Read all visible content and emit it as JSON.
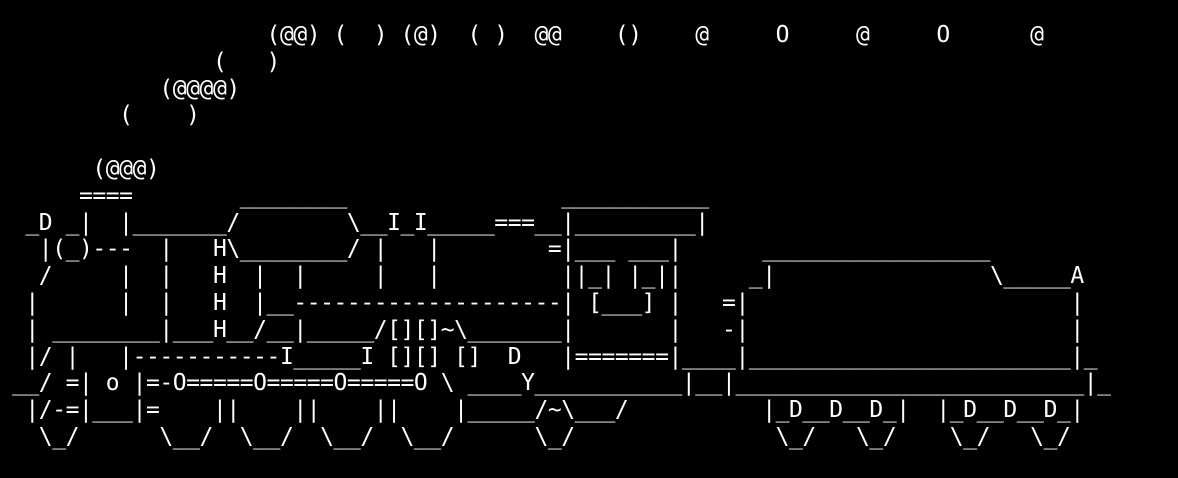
{
  "terminal": {
    "background": "#000000",
    "foreground": "#ffffff",
    "lines": [
      "                   (@@) (  ) (@)  ( )  @@    ()    @     O     @     O      @",
      "               (   )",
      "           (@@@@)",
      "        (    )",
      "",
      "      (@@@)",
      "     ====        ________                ___________",
      " _D _|  |_______/        \\__I_I_____===__|_________|",
      "  |(_)---  |   H\\________/ |   |        =|___ ___|      _________________",
      "  /     |  |   H  |  |     |   |         ||_| |_||     _|                \\_____A",
      " |      |  |   H  |__--------------------| [___] |   =|                        |",
      " | ________|___H__/__|_____/[][]~\\_______|       |   -|                        |",
      " |/ |   |-----------I_____I [][] []  D   |=======|____|________________________|_",
      "__/ =| o |=-O=====O=====O=====O \\ ____Y___________|__|__________________________|_",
      " |/-=|___|=    ||    ||    ||    |_____/~\\___/          |_D__D__D_|  |_D__D__D_|",
      "  \\_/      \\__/  \\__/  \\__/  \\__/      \\_/               \\_/   \\_/    \\_/   \\_/"
    ]
  }
}
